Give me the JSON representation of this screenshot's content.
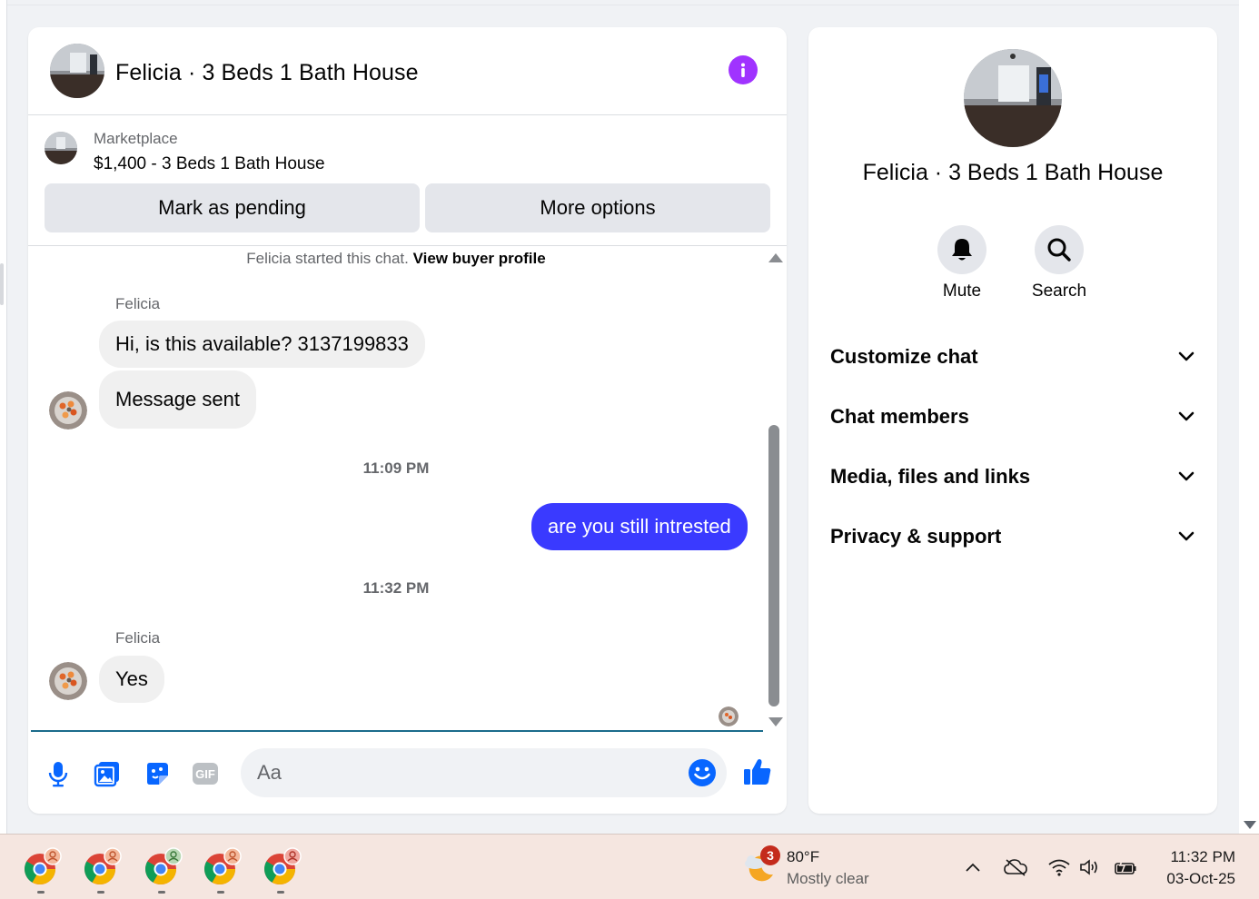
{
  "chat": {
    "title": "Felicia · 3 Beds 1 Bath House",
    "listing": {
      "source": "Marketplace",
      "title": "$1,400 - 3 Beds 1 Bath House",
      "pending_label": "Mark as pending",
      "more_label": "More options"
    },
    "started_text": "Felicia started this chat.",
    "buyer_profile_link": "View buyer profile",
    "messages": [
      {
        "sender": "Felicia",
        "text": "Hi, is this available? 3137199833"
      },
      {
        "text": "Message sent"
      },
      {
        "timestamp": "11:09 PM"
      },
      {
        "text": "are you still intrested",
        "mine": true
      },
      {
        "timestamp": "11:32 PM"
      },
      {
        "sender": "Felicia",
        "text": "Yes"
      }
    ],
    "composer": {
      "placeholder": "Aa"
    },
    "colors": {
      "accent": "#0866ff",
      "own_bubble": "#3a3aff",
      "info": "#a033ff"
    }
  },
  "sidebar": {
    "title": "Felicia · 3 Beds 1 Bath House",
    "actions": [
      {
        "label": "Mute",
        "icon": "bell-icon"
      },
      {
        "label": "Search",
        "icon": "search-icon"
      }
    ],
    "sections": [
      {
        "label": "Customize chat"
      },
      {
        "label": "Chat members"
      },
      {
        "label": "Media, files and links"
      },
      {
        "label": "Privacy & support"
      }
    ]
  },
  "taskbar": {
    "weather": {
      "badge": "3",
      "temp": "80°F",
      "desc": "Mostly clear"
    },
    "clock": {
      "time": "11:32 PM",
      "date": "03-Oct-25"
    }
  }
}
